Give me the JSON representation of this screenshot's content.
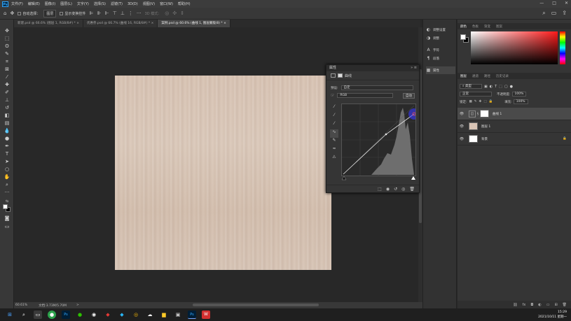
{
  "menubar": {
    "logo": "Ps",
    "items": [
      "文件(F)",
      "编辑(E)",
      "图像(I)",
      "图层(L)",
      "文字(Y)",
      "选择(S)",
      "滤镜(T)",
      "3D(D)",
      "视图(V)",
      "窗口(W)",
      "帮助(H)"
    ],
    "controls": [
      "—",
      "□",
      "✕"
    ]
  },
  "options": {
    "auto_select_label": "自动选择：",
    "layer_dropdown": "图层",
    "transform_label": "显示变换控件",
    "mode3d_label": "3D 模式："
  },
  "tabs": [
    {
      "label": "新建.psd @ 66.6% (图层 1, RGB/8#) *",
      "close": "×"
    },
    {
      "label": "优惠券.psd @ 66.7% (曲线 16, RGB/8#) *",
      "close": "×"
    },
    {
      "label": "案例.psd @ 60.6% (曲线 1, 图层蒙版/8) *",
      "close": "×"
    }
  ],
  "status": {
    "zoom": "60.61%",
    "doc_info": "文档:3.73M/5.70M",
    "arrow": ">"
  },
  "properties": {
    "title": "属性",
    "subtitle": "曲线",
    "preset_label": "预设:",
    "preset_value": "自定",
    "channel_value": "RGB",
    "auto_button": "自动"
  },
  "mid_panel": {
    "items": [
      "调整设置",
      "调整",
      "字符",
      "段落",
      "属性"
    ]
  },
  "color_panel": {
    "tabs": [
      "颜色",
      "色板",
      "渐变",
      "图案"
    ]
  },
  "layers_panel": {
    "tabs": [
      "图层",
      "通道",
      "路径",
      "历史记录"
    ],
    "kind_label": "类型",
    "blend_mode": "正常",
    "opacity_label": "不透明度:",
    "opacity_value": "100%",
    "lock_label": "锁定:",
    "fill_label": "填充:",
    "fill_value": "100%",
    "layers": [
      {
        "name": "曲线 1",
        "thumb_color": "#ffffff",
        "active": true
      },
      {
        "name": "图层 1",
        "thumb_color": "#d9c5b6",
        "active": false
      },
      {
        "name": "背景",
        "thumb_color": "#ffffff",
        "active": false
      }
    ]
  },
  "taskbar": {
    "time": "15:29",
    "date": "2021/10/11 星期一"
  }
}
